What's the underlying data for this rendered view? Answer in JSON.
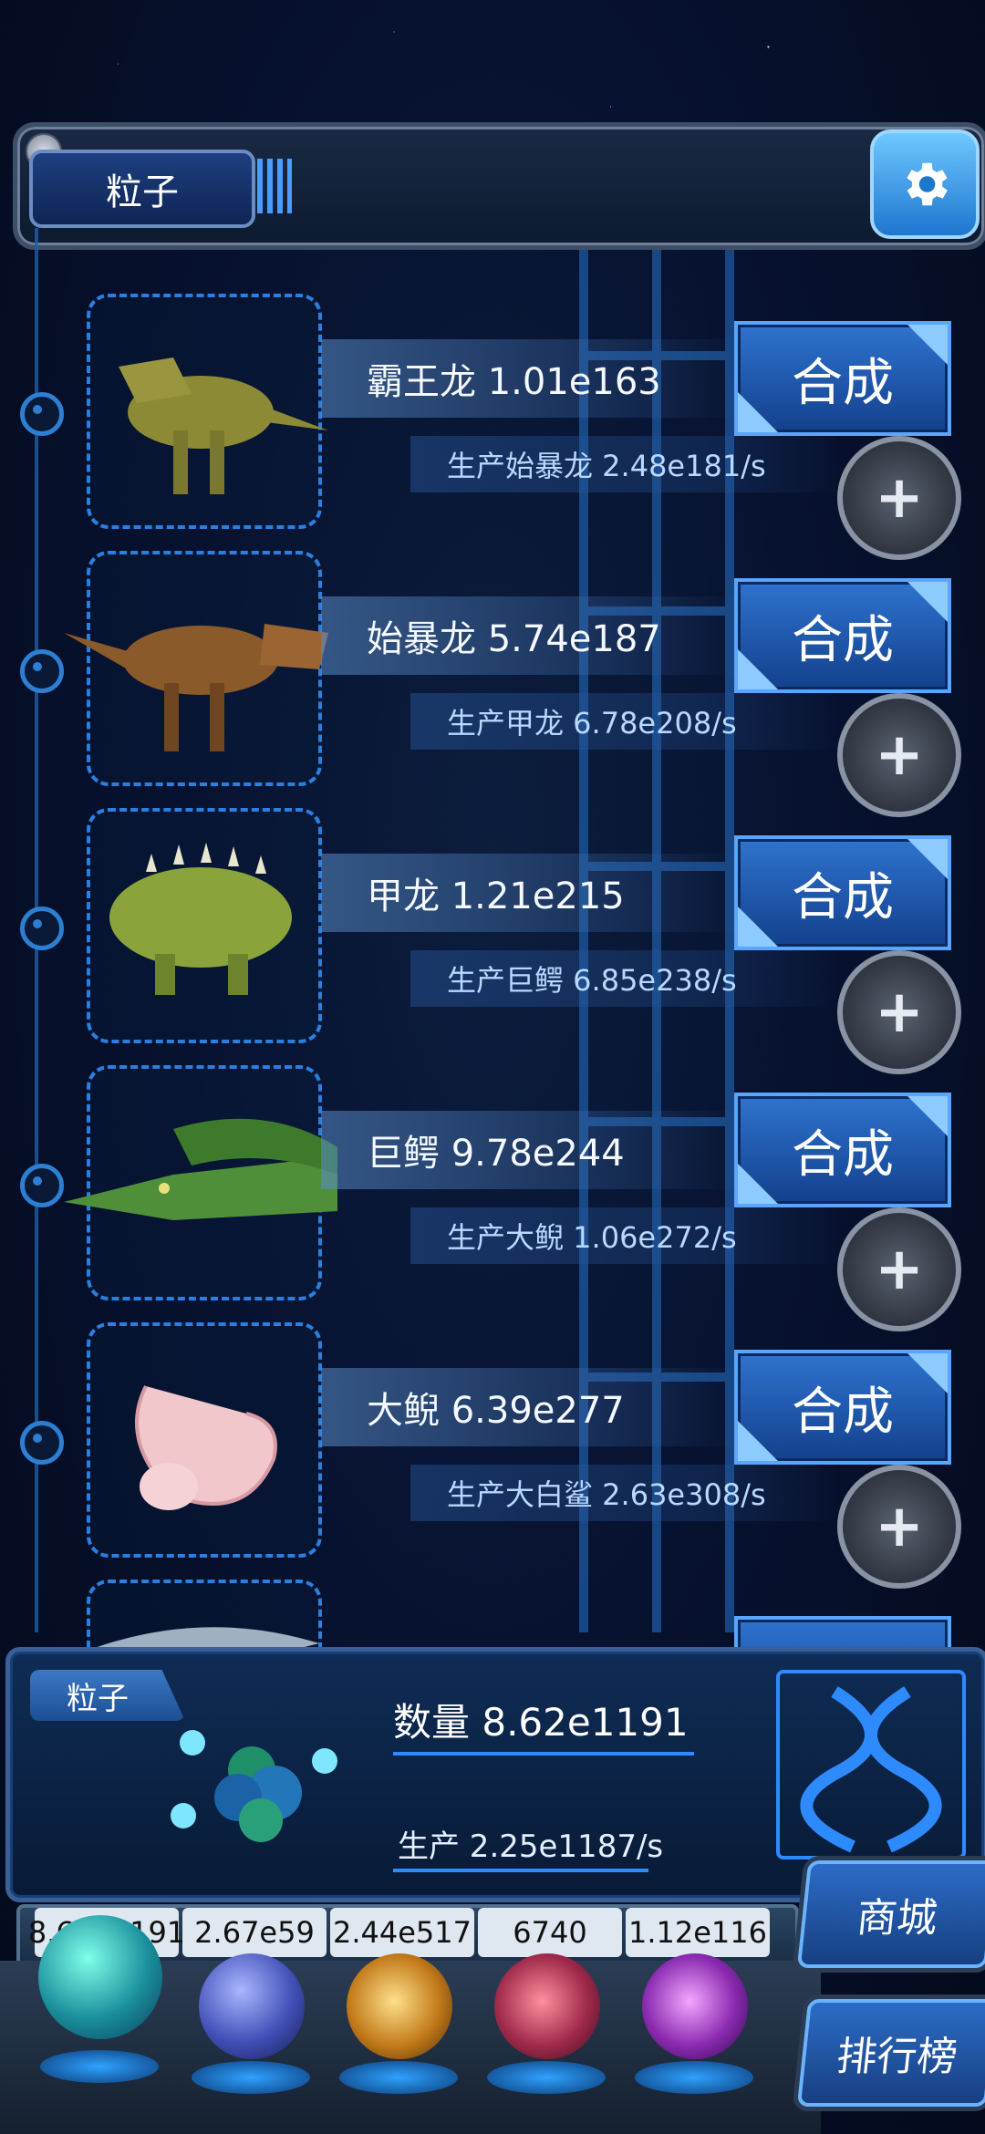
{
  "top_bar": {
    "resource_tab_label": "粒子"
  },
  "creatures": [
    {
      "name": "霸王龙",
      "count": "1.01e163",
      "production": "生产始暴龙 2.48e181/s",
      "button": "合成"
    },
    {
      "name": "始暴龙",
      "count": "5.74e187",
      "production": "生产甲龙 6.78e208/s",
      "button": "合成"
    },
    {
      "name": "甲龙",
      "count": "1.21e215",
      "production": "生产巨鳄 6.85e238/s",
      "button": "合成"
    },
    {
      "name": "巨鳄",
      "count": "9.78e244",
      "production": "生产大鲵 1.06e272/s",
      "button": "合成"
    },
    {
      "name": "大鲵",
      "count": "6.39e277",
      "production": "生产大白鲨 2.63e308/s",
      "button": "合成"
    }
  ],
  "creature_labels": [
    "霸王龙 1.01e163",
    "始暴龙 5.74e187",
    "甲龙 1.21e215",
    "巨鳄 9.78e244",
    "大鲵 6.39e277"
  ],
  "bottom_panel": {
    "tab_label": "粒子",
    "count_label": "数量 8.62e1191",
    "production_label": "生产 2.25e1187/s"
  },
  "currencies": [
    "8.62e1191",
    "2.67e59",
    "2.44e517",
    "6740",
    "1.12e116"
  ],
  "side_buttons": {
    "shop": "商城",
    "ranking": "排行榜"
  },
  "colors": {
    "accent_blue": "#2e73cf",
    "rail_blue": "#2d7fd4",
    "background": "#071230"
  },
  "icons": [
    "gear-icon",
    "plus-icon",
    "particle-orb-icon",
    "lightning-orb-icon",
    "galaxy-orb-icon",
    "brain-orb-icon",
    "vortex-orb-icon",
    "dna-icon"
  ]
}
